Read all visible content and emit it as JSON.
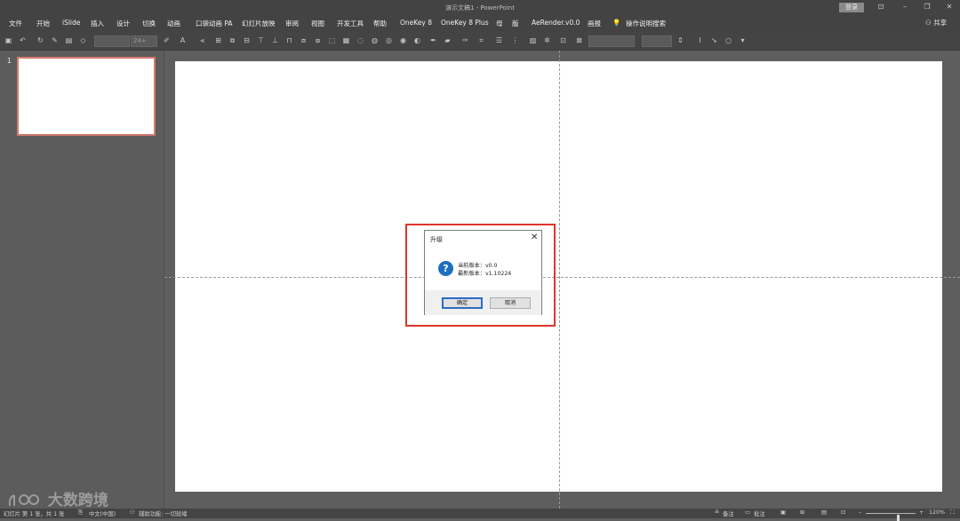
{
  "window": {
    "title": "演示文稿1 - PowerPoint",
    "login_label": "登录",
    "controls": [
      "restore-panel-icon",
      "minimize-icon",
      "maximize-icon",
      "close-icon"
    ]
  },
  "ribbon": {
    "tabs": [
      "文件",
      "开始",
      "iSlide",
      "插入",
      "设计",
      "切换",
      "动画",
      "口袋动画 PA",
      "幻灯片放映",
      "审阅",
      "视图",
      "开发工具",
      "帮助",
      "OneKey 8",
      "OneKey 8 Plus",
      "母",
      "版",
      "AeRender.v0.0",
      "画报"
    ],
    "search_label": "操作说明搜索",
    "share_label": "共享"
  },
  "toolbar": {
    "font_size_value": "24+"
  },
  "thumbnails": {
    "slide_number": "1"
  },
  "dialog": {
    "title": "升级",
    "current_version_label": "当前版本：",
    "current_version": "v0.0",
    "latest_version_label": "最新版本：",
    "latest_version": "v1.10224",
    "ok_label": "确定",
    "cancel_label": "取消",
    "icon": "question-icon"
  },
  "statusbar": {
    "slide_info": "幻灯片 第 1 张，共 1 张",
    "language": "中文(中国)",
    "accessibility": "辅助功能: 一切就绪",
    "notes_label": "备注",
    "comments_label": "批注",
    "zoom": "120%"
  },
  "watermark": {
    "text": "大数跨境"
  },
  "colors": {
    "highlight": "#e0342a",
    "thumb_border": "#d37a6b",
    "dialog_primary": "#2b6cc4",
    "question_icon": "#1f6fbf"
  }
}
